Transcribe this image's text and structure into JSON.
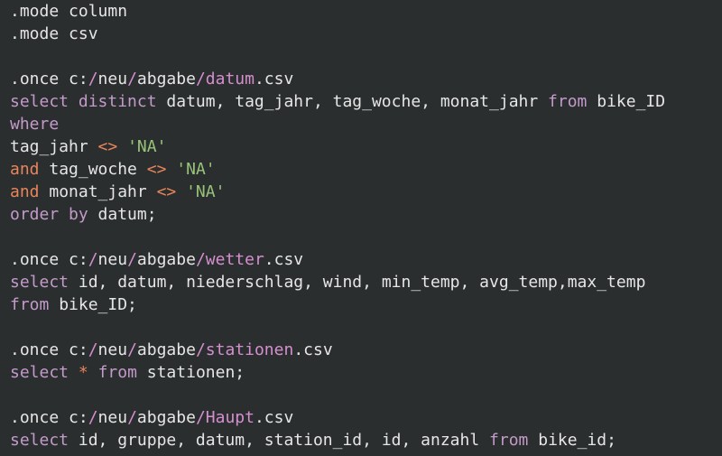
{
  "colors": {
    "background": "#2b2e2f",
    "default": "#e6e6e6",
    "keyword": "#c39ac9",
    "operator": "#e8855a",
    "string": "#98c379",
    "path": "#d58fcf"
  },
  "code": {
    "lines": [
      [
        {
          "t": ".mode column",
          "k": "default"
        }
      ],
      [
        {
          "t": ".mode csv",
          "k": "default"
        }
      ],
      [],
      [
        {
          "t": ".once c:",
          "k": "default"
        },
        {
          "t": "/",
          "k": "path"
        },
        {
          "t": "neu",
          "k": "default"
        },
        {
          "t": "/",
          "k": "path"
        },
        {
          "t": "abgabe",
          "k": "default"
        },
        {
          "t": "/datum",
          "k": "path"
        },
        {
          "t": ".csv",
          "k": "default"
        }
      ],
      [
        {
          "t": "select distinct",
          "k": "keyword"
        },
        {
          "t": " datum, tag_jahr, tag_woche, monat_jahr ",
          "k": "default"
        },
        {
          "t": "from",
          "k": "keyword"
        },
        {
          "t": " bike_ID",
          "k": "default"
        }
      ],
      [
        {
          "t": "where",
          "k": "keyword"
        }
      ],
      [
        {
          "t": "tag_jahr ",
          "k": "default"
        },
        {
          "t": "<>",
          "k": "op"
        },
        {
          "t": " ",
          "k": "default"
        },
        {
          "t": "'NA'",
          "k": "string"
        }
      ],
      [
        {
          "t": "and",
          "k": "op"
        },
        {
          "t": " tag_woche ",
          "k": "default"
        },
        {
          "t": "<>",
          "k": "op"
        },
        {
          "t": " ",
          "k": "default"
        },
        {
          "t": "'NA'",
          "k": "string"
        }
      ],
      [
        {
          "t": "and",
          "k": "op"
        },
        {
          "t": " monat_jahr ",
          "k": "default"
        },
        {
          "t": "<>",
          "k": "op"
        },
        {
          "t": " ",
          "k": "default"
        },
        {
          "t": "'NA'",
          "k": "string"
        }
      ],
      [
        {
          "t": "order by",
          "k": "keyword"
        },
        {
          "t": " datum;",
          "k": "default"
        }
      ],
      [],
      [
        {
          "t": ".once c:",
          "k": "default"
        },
        {
          "t": "/",
          "k": "path"
        },
        {
          "t": "neu",
          "k": "default"
        },
        {
          "t": "/",
          "k": "path"
        },
        {
          "t": "abgabe",
          "k": "default"
        },
        {
          "t": "/wetter",
          "k": "path"
        },
        {
          "t": ".csv",
          "k": "default"
        }
      ],
      [
        {
          "t": "select",
          "k": "keyword"
        },
        {
          "t": " id, datum, niederschlag, wind, min_temp, avg_temp,max_temp",
          "k": "default"
        }
      ],
      [
        {
          "t": "from",
          "k": "keyword"
        },
        {
          "t": " bike_ID;",
          "k": "default"
        }
      ],
      [],
      [
        {
          "t": ".once c:",
          "k": "default"
        },
        {
          "t": "/",
          "k": "path"
        },
        {
          "t": "neu",
          "k": "default"
        },
        {
          "t": "/",
          "k": "path"
        },
        {
          "t": "abgabe",
          "k": "default"
        },
        {
          "t": "/stationen",
          "k": "path"
        },
        {
          "t": ".csv",
          "k": "default"
        }
      ],
      [
        {
          "t": "select",
          "k": "keyword"
        },
        {
          "t": " ",
          "k": "default"
        },
        {
          "t": "*",
          "k": "op"
        },
        {
          "t": " ",
          "k": "default"
        },
        {
          "t": "from",
          "k": "keyword"
        },
        {
          "t": " stationen;",
          "k": "default"
        }
      ],
      [],
      [
        {
          "t": ".once c:",
          "k": "default"
        },
        {
          "t": "/",
          "k": "path"
        },
        {
          "t": "neu",
          "k": "default"
        },
        {
          "t": "/",
          "k": "path"
        },
        {
          "t": "abgabe",
          "k": "default"
        },
        {
          "t": "/Haupt",
          "k": "path"
        },
        {
          "t": ".csv",
          "k": "default"
        }
      ],
      [
        {
          "t": "select",
          "k": "keyword"
        },
        {
          "t": " id, gruppe, datum, station_id, id, anzahl ",
          "k": "default"
        },
        {
          "t": "from",
          "k": "keyword"
        },
        {
          "t": " bike_id;",
          "k": "default"
        }
      ]
    ]
  }
}
